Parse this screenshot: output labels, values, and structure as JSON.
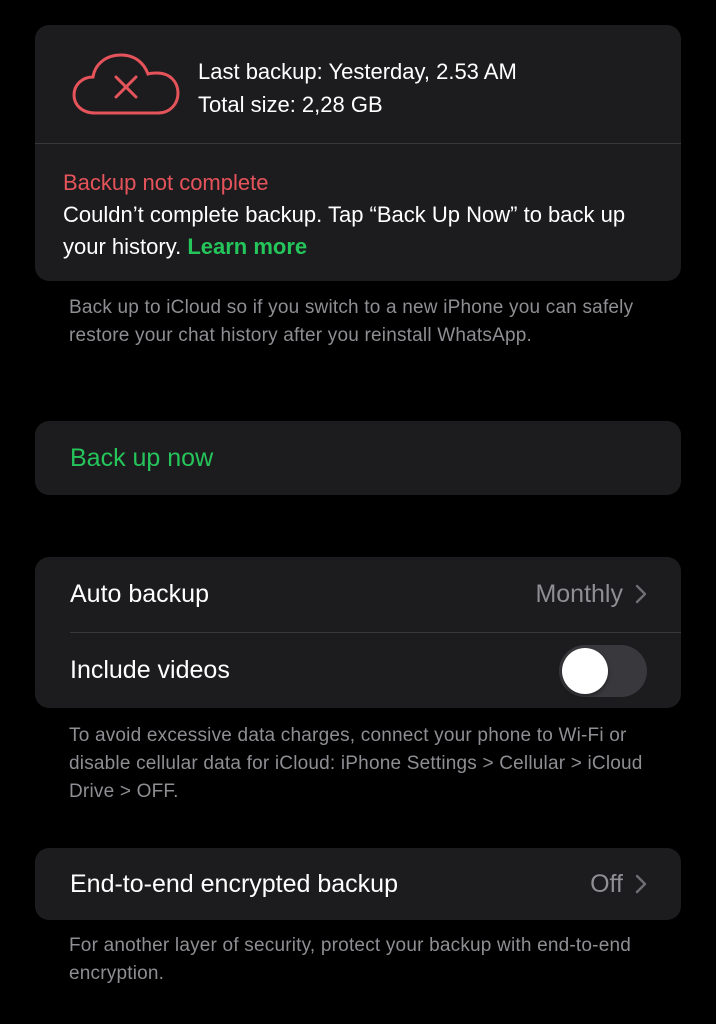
{
  "status": {
    "last_backup": "Last backup: Yesterday, 2.53 AM",
    "total_size": "Total size: 2,28 GB",
    "error_title": "Backup not complete",
    "error_message": "Couldn’t complete backup. Tap “Back Up Now” to back up your history.",
    "learn_more": "Learn more",
    "icon": "cloud-error-icon",
    "error_color": "#e5535b"
  },
  "icloud_note": "Back up to iCloud so if you switch to a new iPhone you can safely restore your chat history after you reinstall WhatsApp.",
  "backup_now": {
    "label": "Back up now",
    "color": "#25c55b"
  },
  "settings": {
    "auto_backup": {
      "label": "Auto backup",
      "value": "Monthly"
    },
    "include_videos": {
      "label": "Include videos",
      "enabled": false
    }
  },
  "cellular_note": "To avoid excessive data charges, connect your phone to Wi-Fi or disable cellular data for iCloud: iPhone Settings > Cellular > iCloud Drive > OFF.",
  "encryption": {
    "label": "End-to-end encrypted backup",
    "value": "Off"
  },
  "encryption_note": "For another layer of security, protect your backup with end-to-end encryption."
}
